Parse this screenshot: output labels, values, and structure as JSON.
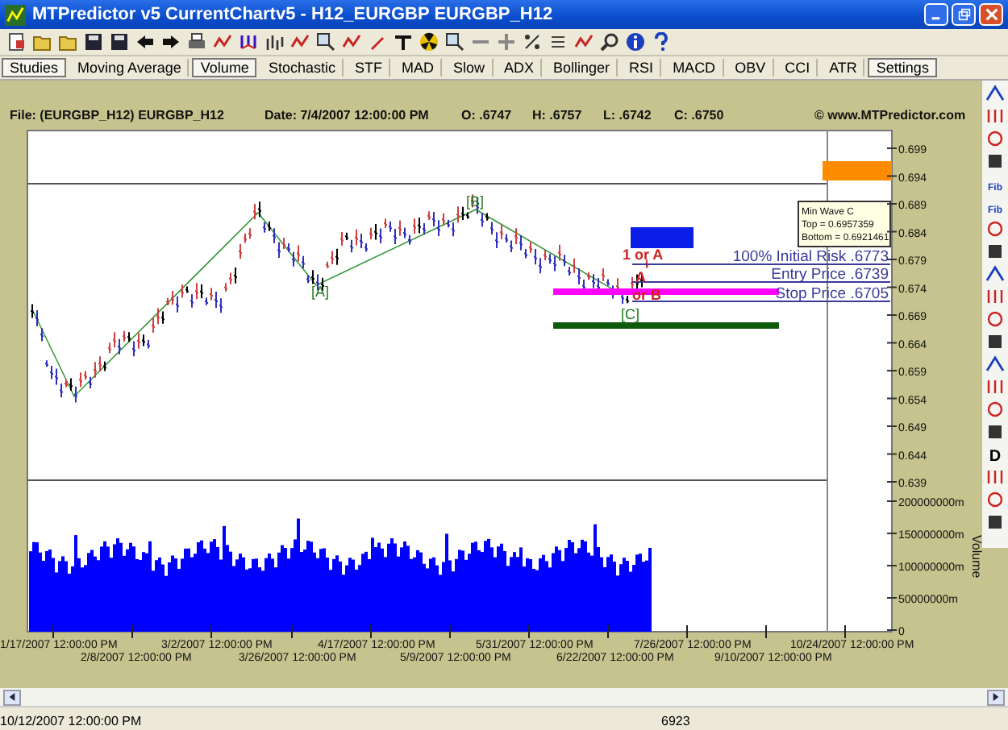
{
  "window": {
    "title": "MTPredictor v5 CurrentChartv5 - H12_EURGBP EURGBP_H12"
  },
  "tabs": [
    {
      "label": "Studies",
      "pressed": true
    },
    {
      "label": "Moving Average",
      "pressed": false
    },
    {
      "label": "Volume",
      "pressed": true
    },
    {
      "label": "Stochastic",
      "pressed": false
    },
    {
      "label": "STF",
      "pressed": false
    },
    {
      "label": "MAD",
      "pressed": false
    },
    {
      "label": "Slow",
      "pressed": false
    },
    {
      "label": "ADX",
      "pressed": false
    },
    {
      "label": "Bollinger",
      "pressed": false
    },
    {
      "label": "RSI",
      "pressed": false
    },
    {
      "label": "MACD",
      "pressed": false
    },
    {
      "label": "OBV",
      "pressed": false
    },
    {
      "label": "CCI",
      "pressed": false
    },
    {
      "label": "ATR",
      "pressed": false
    },
    {
      "label": "Settings",
      "pressed": true
    }
  ],
  "chart_header": {
    "file": "File: (EURGBP_H12) EURGBP_H12",
    "date": "Date: 7/4/2007 12:00:00 PM",
    "open": "O: .6747",
    "high": "H: .6757",
    "low": "L: .6742",
    "close": "C: .6750",
    "copyright": "© www.MTPredictor.com"
  },
  "price_axis": [
    "0.699",
    "0.694",
    "0.689",
    "0.684",
    "0.679",
    "0.674",
    "0.669",
    "0.664",
    "0.659",
    "0.654",
    "0.649",
    "0.644",
    "0.639"
  ],
  "volume_axis": {
    "title": "Volume",
    "ticks": [
      "200000000m",
      "150000000m",
      "100000000m",
      "50000000m",
      "0"
    ]
  },
  "date_axis": [
    "1/17/2007 12:00:00 PM",
    "2/8/2007 12:00:00 PM",
    "3/2/2007 12:00:00 PM",
    "3/26/2007 12:00:00 PM",
    "4/17/2007 12:00:00 PM",
    "5/9/2007 12:00:00 PM",
    "5/31/2007 12:00:00 PM",
    "6/22/2007 12:00:00 PM",
    "7/26/2007 12:00:00 PM",
    "9/10/2007 12:00:00 PM",
    "10/24/2007 12:00:00 PM"
  ],
  "wave_labels": [
    {
      "text": "[A]",
      "kind": "wave"
    },
    {
      "text": "[B]",
      "kind": "wave"
    },
    {
      "text": "[C]",
      "kind": "wave"
    },
    {
      "text": "1 or A",
      "kind": "target"
    },
    {
      "text": "A",
      "kind": "target"
    },
    {
      "text": "or B",
      "kind": "target"
    }
  ],
  "trade_levels": [
    {
      "label": "100% Initial Risk .6773"
    },
    {
      "label": "Entry Price .6739"
    },
    {
      "label": "Stop Price .6705"
    }
  ],
  "tooltip": {
    "title": "Min Wave C",
    "lines": [
      "Top = 0.6957359",
      "Bottom = 0.6921461"
    ]
  },
  "right_toolbar": [
    {
      "kind": "icon"
    },
    {
      "kind": "icon"
    },
    {
      "kind": "icon"
    },
    {
      "kind": "icon"
    },
    {
      "kind": "text",
      "label": "Fib"
    },
    {
      "kind": "text",
      "label": "Fib"
    },
    {
      "kind": "icon"
    },
    {
      "kind": "icon"
    },
    {
      "kind": "icon"
    },
    {
      "kind": "icon"
    },
    {
      "kind": "icon"
    },
    {
      "kind": "icon"
    },
    {
      "kind": "icon"
    },
    {
      "kind": "icon"
    },
    {
      "kind": "icon"
    },
    {
      "kind": "icon"
    },
    {
      "kind": "text",
      "label": "D"
    },
    {
      "kind": "icon"
    },
    {
      "kind": "icon"
    },
    {
      "kind": "icon"
    }
  ],
  "status_bar": {
    "date": "10/12/2007 12:00:00 PM",
    "count": "6923"
  }
}
